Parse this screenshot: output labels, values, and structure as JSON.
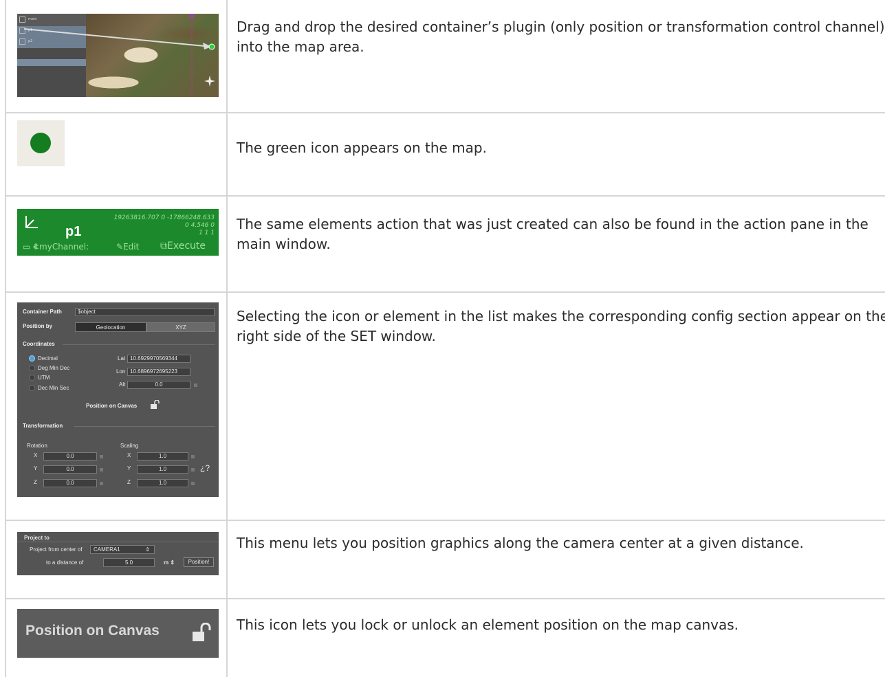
{
  "rows": [
    {
      "description": "Drag and drop the desired container’s plugin (only position or transformation control channel) into the map area.",
      "screenshot": {
        "tree_items": [
          "main",
          "p1",
          "p2"
        ]
      }
    },
    {
      "description": "The green icon appears on the map.",
      "icon": {
        "name": "green-dot-icon",
        "color": "#137d1f"
      }
    },
    {
      "description": "The same elements action that was just created can also be found in the action pane in the main window.",
      "action": {
        "name": "p1",
        "coords": [
          "19263816.707 0 -17866248.633",
          "0 4.546 0",
          "1 1 1"
        ],
        "channel": "<myChannel:",
        "edit": "Edit",
        "execute": "Execute",
        "bg_color": "#1c8a2c"
      }
    },
    {
      "description": "Selecting the icon or element in the list makes the corresponding config section appear on the right side of the SET window.",
      "config": {
        "container_path_label": "Container Path",
        "container_path_value": "$object",
        "position_by_label": "Position by",
        "position_by_options": [
          "Geolocation",
          "XYZ"
        ],
        "coordinates_label": "Coordinates",
        "formats": [
          "Decimal",
          "Deg Min Dec",
          "UTM",
          "Dec Min Sec"
        ],
        "selected_format": "Decimal",
        "lat_label": "Lat",
        "lat_value": "10.6929970569344",
        "lon_label": "Lon",
        "lon_value": "10.6896972695223",
        "alt_label": "Alt",
        "alt_value": "0.0",
        "position_on_canvas": "Position on Canvas",
        "transformation_label": "Transformation",
        "rotation_label": "Rotation",
        "scaling_label": "Scaling",
        "axes": [
          "X",
          "Y",
          "Z"
        ],
        "rotation_values": [
          "0.0",
          "0.0",
          "0.0"
        ],
        "scaling_values": [
          "1.0",
          "1.0",
          "1.0"
        ],
        "help_glyph": "¿?"
      }
    },
    {
      "description": "This menu lets you position graphics along the camera center at a given distance.",
      "project": {
        "title": "Project to",
        "from_label": "Project from center of",
        "camera_value": "CAMERA1",
        "distance_label": "to a distance of",
        "distance_value": "5.0",
        "unit": "m",
        "button": "Position!"
      }
    },
    {
      "description": "This icon lets you lock or unlock an element position on the map canvas.",
      "canvas": {
        "label": "Position on Canvas"
      }
    }
  ]
}
